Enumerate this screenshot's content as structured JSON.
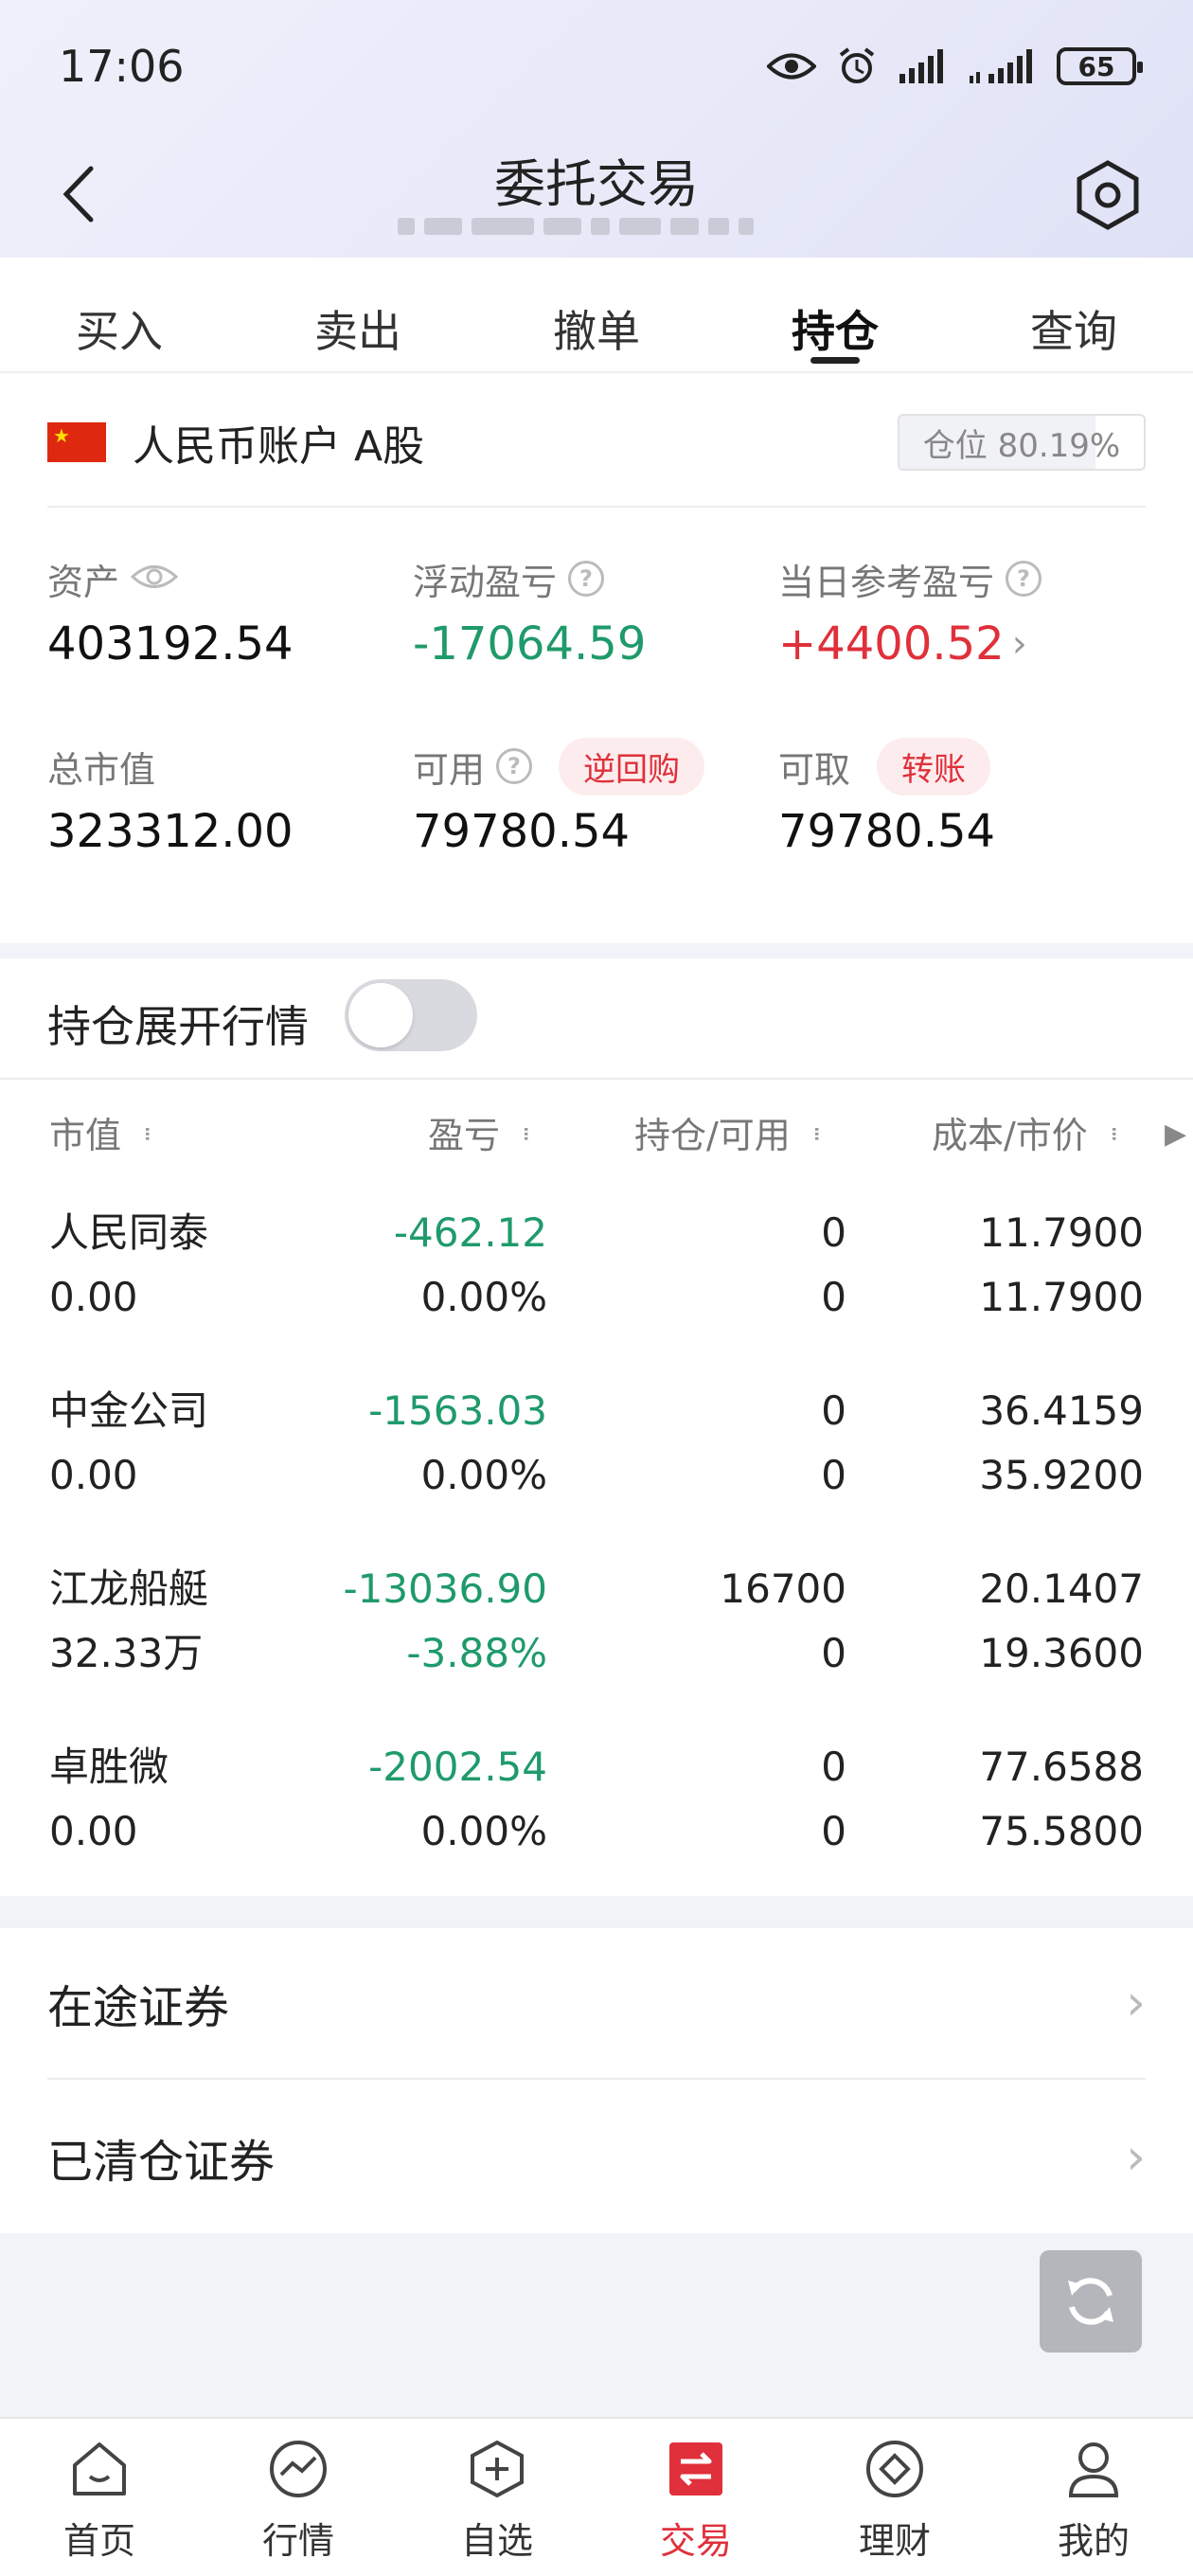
{
  "status_bar": {
    "time": "17:06",
    "battery": "65"
  },
  "header": {
    "title": "委托交易"
  },
  "tabs": [
    {
      "label": "买入",
      "active": false
    },
    {
      "label": "卖出",
      "active": false
    },
    {
      "label": "撤单",
      "active": false
    },
    {
      "label": "持仓",
      "active": true
    },
    {
      "label": "查询",
      "active": false
    }
  ],
  "account": {
    "name": "人民币账户 A股",
    "position_label": "仓位 80.19%",
    "position_ratio": 0.8019
  },
  "summary": {
    "assets": {
      "label": "资产",
      "value": "403192.54"
    },
    "floating_pnl": {
      "label": "浮动盈亏",
      "value": "-17064.59"
    },
    "daily_pnl": {
      "label": "当日参考盈亏",
      "value": "+4400.52"
    },
    "market_value": {
      "label": "总市值",
      "value": "323312.00"
    },
    "available": {
      "label": "可用",
      "value": "79780.54",
      "badge": "逆回购"
    },
    "withdrawable": {
      "label": "可取",
      "value": "79780.54",
      "badge": "转账"
    }
  },
  "toggle": {
    "label": "持仓展开行情",
    "on": false
  },
  "table": {
    "headers": {
      "market_value": "市值",
      "pnl": "盈亏",
      "holding": "持仓/可用",
      "cost_price": "成本/市价"
    },
    "rows": [
      {
        "name": "人民同泰",
        "market_value": "0.00",
        "pnl": "-462.12",
        "pnl_pct": "0.00%",
        "holding": "0",
        "available": "0",
        "cost": "11.7900",
        "price": "11.7900",
        "pnl_pct_neg": false
      },
      {
        "name": "中金公司",
        "market_value": "0.00",
        "pnl": "-1563.03",
        "pnl_pct": "0.00%",
        "holding": "0",
        "available": "0",
        "cost": "36.4159",
        "price": "35.9200",
        "pnl_pct_neg": false
      },
      {
        "name": "江龙船艇",
        "market_value": "32.33万",
        "pnl": "-13036.90",
        "pnl_pct": "-3.88%",
        "holding": "16700",
        "available": "0",
        "cost": "20.1407",
        "price": "19.3600",
        "pnl_pct_neg": true
      },
      {
        "name": "卓胜微",
        "market_value": "0.00",
        "pnl": "-2002.54",
        "pnl_pct": "0.00%",
        "holding": "0",
        "available": "0",
        "cost": "77.6588",
        "price": "75.5800",
        "pnl_pct_neg": false
      }
    ]
  },
  "links": {
    "in_transit": "在途证券",
    "cleared": "已清仓证券"
  },
  "bottom_nav": [
    {
      "label": "首页",
      "icon": "home-icon",
      "active": false
    },
    {
      "label": "行情",
      "icon": "market-icon",
      "active": false
    },
    {
      "label": "自选",
      "icon": "watchlist-icon",
      "active": false
    },
    {
      "label": "交易",
      "icon": "trade-icon",
      "active": true
    },
    {
      "label": "理财",
      "icon": "wealth-icon",
      "active": false
    },
    {
      "label": "我的",
      "icon": "profile-icon",
      "active": false
    }
  ],
  "colors": {
    "gain": "#e0303b",
    "loss": "#1f9a6b",
    "accent": "#e0303b"
  }
}
